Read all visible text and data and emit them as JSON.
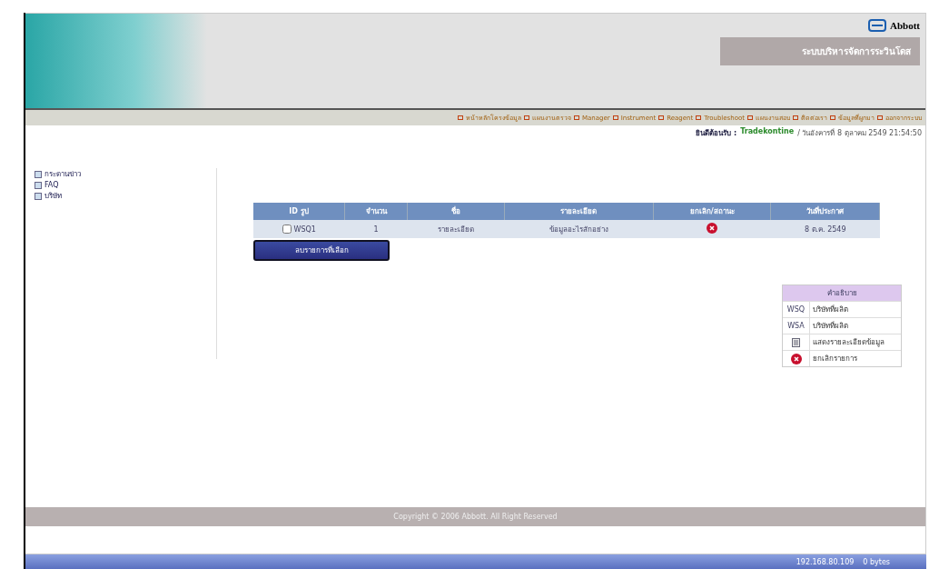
{
  "header": {
    "brand": "Abbott",
    "system_title": "ระบบบริหารจัดการระวินโดส"
  },
  "menu": [
    "หน้าหลักโครงข้อมูล",
    "แผนงานตรวจ",
    "Manager",
    "Instrument",
    "Reagent",
    "Troubleshoot",
    "แผนงานสอบ",
    "ติดต่อเรา",
    "ข้อมูลที่ผูกมา",
    "ออกจากระบบ"
  ],
  "welcome": {
    "label": "ยินดีต้อนรับ :",
    "user": "Tradekontine",
    "date": "/ วันอังคารที่ 8 ตุลาคม 2549 21:54:50"
  },
  "sidebar": {
    "items": [
      "กระดานข่าว",
      "FAQ",
      "บริษัท"
    ]
  },
  "table": {
    "columns": [
      "ID รูป",
      "จำนวน",
      "ชื่อ",
      "รายละเอียด",
      "ยกเลิก/สถานะ",
      "วันที่ประกาศ"
    ],
    "rows": [
      {
        "checked": false,
        "id": "WSQ1",
        "count": "1",
        "name": "รายละเอียด",
        "detail": "ข้อมูลอะไรสักอย่าง",
        "date": "8 ต.ค. 2549"
      }
    ]
  },
  "delete_button": "ลบรายการที่เลือก",
  "legend": {
    "title": "คำอธิบาย",
    "rows": [
      {
        "kind": "code",
        "code": "WSQ",
        "text": "บริษัทที่ผลิต"
      },
      {
        "kind": "code",
        "code": "WSA",
        "text": "บริษัทที่ผลิต"
      },
      {
        "kind": "doc",
        "text": "แสดงรายละเอียดข้อมูล"
      },
      {
        "kind": "cancel",
        "text": "ยกเลิกรายการ"
      }
    ]
  },
  "footer": "Copyright © 2006 Abbott. All Right Reserved",
  "status_bar": {
    "address": "192.168.80.109",
    "size": "0 bytes"
  }
}
